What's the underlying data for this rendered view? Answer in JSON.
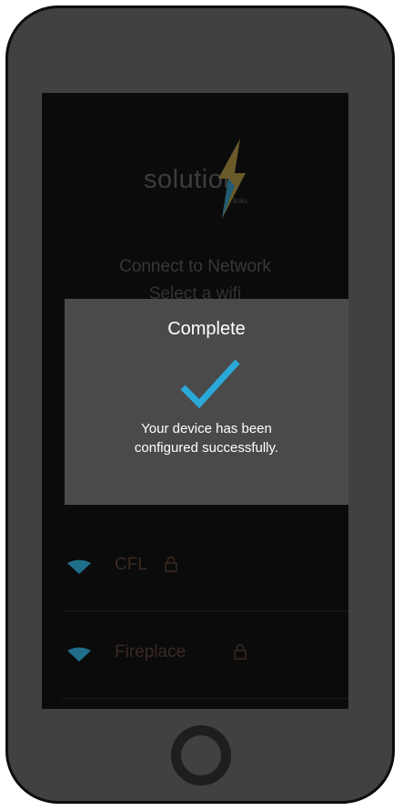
{
  "app": {
    "logo_word": "solution",
    "logo_sub": "links"
  },
  "screen": {
    "heading": "Connect to Network",
    "subheading": "Select a wifi"
  },
  "networks": [
    {
      "name": "CFL",
      "secured": true,
      "icon": "wifi-icon"
    },
    {
      "name": "Fireplace",
      "secured": true,
      "icon": "wifi-icon"
    }
  ],
  "dialog": {
    "title": "Complete",
    "icon": "checkmark-icon",
    "message_line1": "Your device has been",
    "message_line2": "configured successfully."
  },
  "colors": {
    "accent": "#2aa9d9",
    "bolt_gold": "#b0923a",
    "dialog_bg": "#4a4a4a",
    "phone_body": "#414141",
    "screen_bg": "#0b0b0b"
  }
}
